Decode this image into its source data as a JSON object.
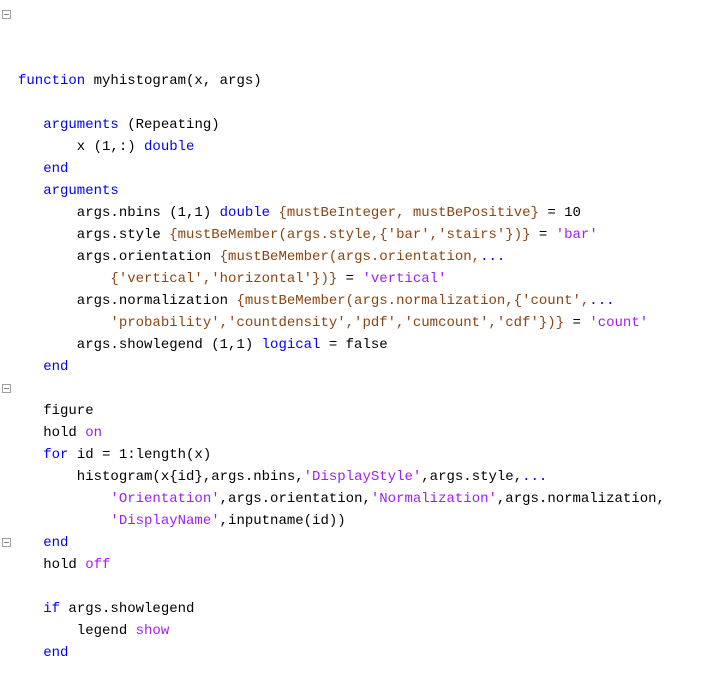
{
  "lines": [
    [
      [
        "kw",
        "function"
      ],
      [
        "",
        ""
      ],
      [
        "",
        " myhistogram(x, args)"
      ]
    ],
    [
      [
        "",
        "   "
      ]
    ],
    [
      [
        "kw",
        "   arguments"
      ],
      [
        "",
        " (Repeating)"
      ]
    ],
    [
      [
        "",
        "       x (1,:) "
      ],
      [
        "kw",
        "double"
      ]
    ],
    [
      [
        "kw",
        "   end"
      ]
    ],
    [
      [
        "kw",
        "   arguments"
      ]
    ],
    [
      [
        "",
        "       args.nbins (1,1) "
      ],
      [
        "kw",
        "double"
      ],
      [
        "",
        " "
      ],
      [
        "val",
        "{mustBeInteger, mustBePositive}"
      ],
      [
        "",
        " = 10"
      ]
    ],
    [
      [
        "",
        "       args.style "
      ],
      [
        "val",
        "{mustBeMember(args.style,{'bar','stairs'})}"
      ],
      [
        "",
        " = "
      ],
      [
        "str",
        "'bar'"
      ]
    ],
    [
      [
        "",
        "       args.orientation "
      ],
      [
        "val",
        "{mustBeMember(args.orientation,"
      ],
      [
        "kw",
        "..."
      ]
    ],
    [
      [
        "val",
        "           {'vertical','horizontal'})}"
      ],
      [
        "",
        " = "
      ],
      [
        "str",
        "'vertical'"
      ]
    ],
    [
      [
        "",
        "       args.normalization "
      ],
      [
        "val",
        "{mustBeMember(args.normalization,{'count',"
      ],
      [
        "kw",
        "..."
      ]
    ],
    [
      [
        "val",
        "           'probability','countdensity','pdf','cumcount','cdf'})}"
      ],
      [
        "",
        " = "
      ],
      [
        "str",
        "'count'"
      ]
    ],
    [
      [
        "",
        "       args.showlegend (1,1) "
      ],
      [
        "kw",
        "logical"
      ],
      [
        "",
        " = false"
      ]
    ],
    [
      [
        "kw",
        "   end"
      ]
    ],
    [
      [
        "",
        "   "
      ]
    ],
    [
      [
        "",
        "   figure"
      ]
    ],
    [
      [
        "",
        "   hold "
      ],
      [
        "str",
        "on"
      ]
    ],
    [
      [
        "kw",
        "   for"
      ],
      [
        "",
        " id = 1:length(x)"
      ]
    ],
    [
      [
        "",
        "       histogram(x{id},args.nbins,"
      ],
      [
        "str",
        "'DisplayStyle'"
      ],
      [
        "",
        ",args.style,"
      ],
      [
        "kw",
        "..."
      ]
    ],
    [
      [
        "",
        "           "
      ],
      [
        "str",
        "'Orientation'"
      ],
      [
        "",
        ",args.orientation,"
      ],
      [
        "str",
        "'Normalization'"
      ],
      [
        "",
        ",args.normalization,"
      ]
    ],
    [
      [
        "",
        "           "
      ],
      [
        "str",
        "'DisplayName'"
      ],
      [
        "",
        ",inputname(id))"
      ]
    ],
    [
      [
        "kw",
        "   end"
      ]
    ],
    [
      [
        "",
        "   hold "
      ],
      [
        "str",
        "off"
      ]
    ],
    [
      [
        "",
        "   "
      ]
    ],
    [
      [
        "kw",
        "   if"
      ],
      [
        "",
        " args.showlegend"
      ]
    ],
    [
      [
        "",
        "       legend "
      ],
      [
        "str",
        "show"
      ]
    ],
    [
      [
        "kw",
        "   end"
      ]
    ]
  ],
  "fold_rows": [
    0,
    17,
    24
  ]
}
